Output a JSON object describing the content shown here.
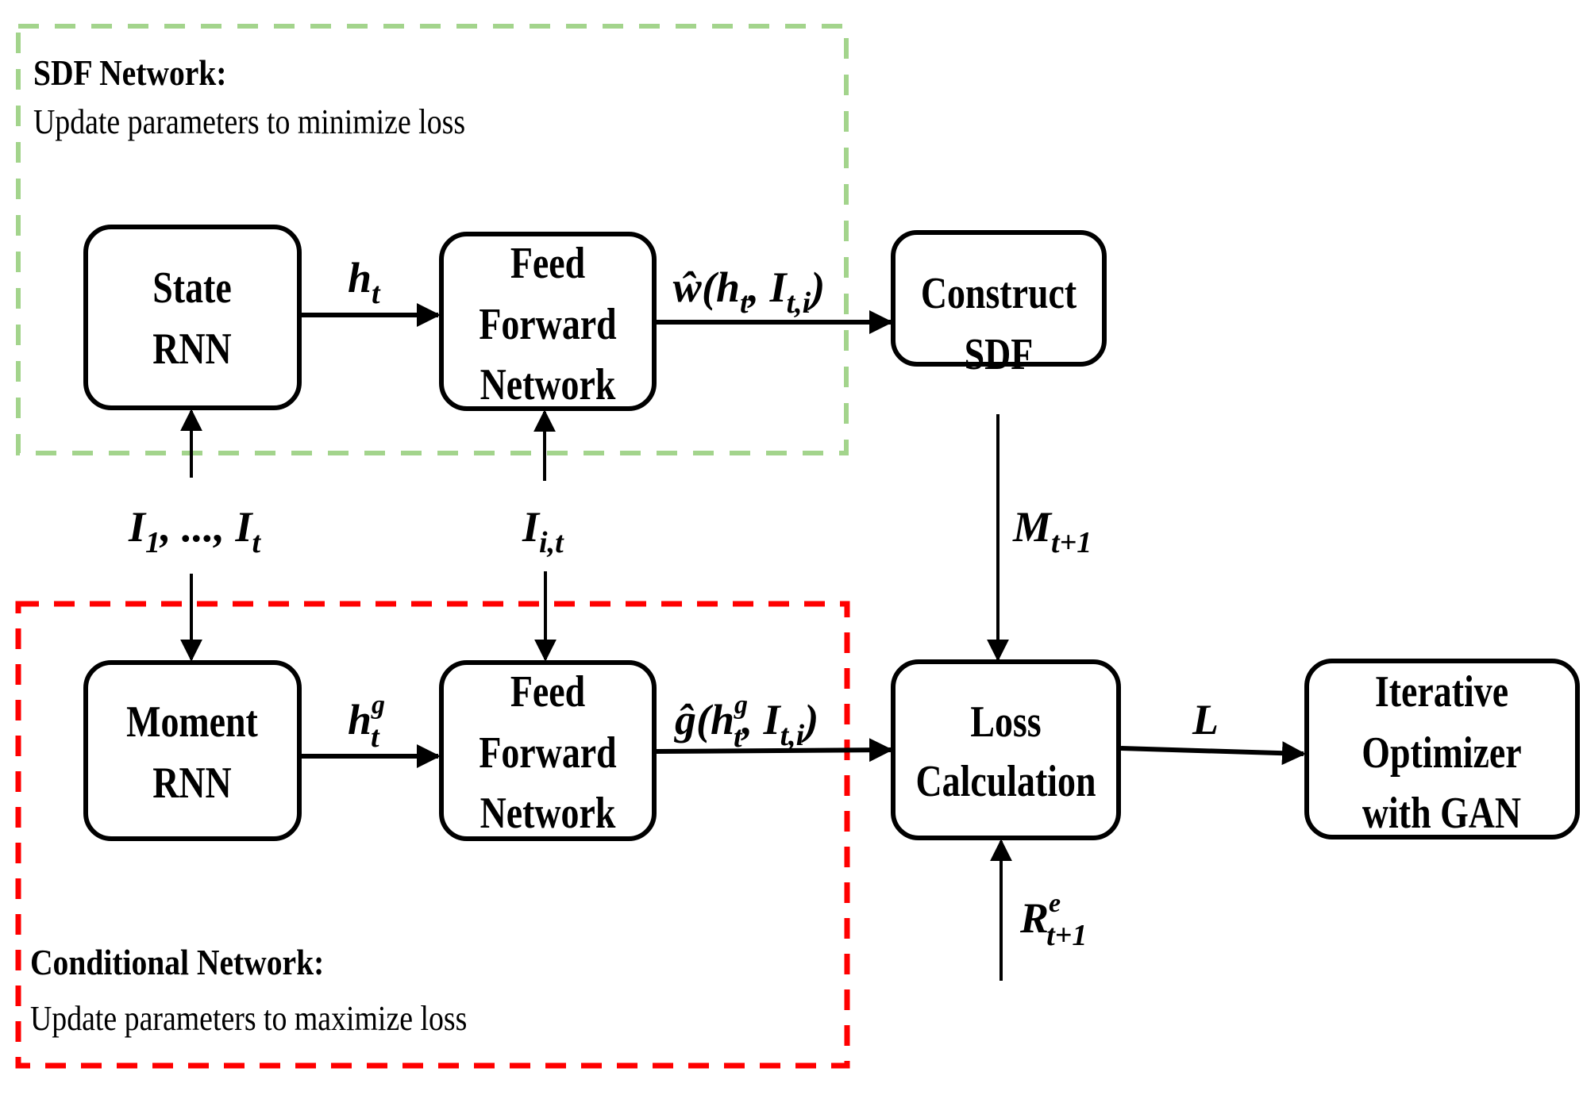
{
  "colors": {
    "sdf_region": "#a3d48c",
    "conditional_region": "#ff0000",
    "box_stroke": "#000000",
    "arrow": "#000000"
  },
  "regions": {
    "sdf": {
      "title": "SDF Network:",
      "subtitle": "Update parameters to minimize loss"
    },
    "conditional": {
      "title": "Conditional Network:",
      "subtitle": "Update parameters to maximize loss"
    }
  },
  "nodes": {
    "state_rnn": {
      "lines": [
        "State",
        "RNN"
      ]
    },
    "ffn_top": {
      "lines": [
        "Feed",
        "Forward",
        "Network"
      ]
    },
    "construct_sdf": {
      "lines": [
        "Construct",
        "SDF"
      ]
    },
    "moment_rnn": {
      "lines": [
        "Moment",
        "RNN"
      ]
    },
    "ffn_bottom": {
      "lines": [
        "Feed",
        "Forward",
        "Network"
      ]
    },
    "loss_calc": {
      "lines": [
        "Loss",
        "Calculation"
      ]
    },
    "optimizer": {
      "lines": [
        "Iterative",
        "Optimizer",
        "with GAN"
      ]
    }
  },
  "edges": {
    "h_t": {
      "base": "h",
      "sub": "t",
      "from": "State RNN",
      "to": "Feed Forward Network (top)"
    },
    "w_hat": {
      "text": "ŵ(h",
      "sub1": "t",
      "mid": ", I",
      "sub2": "t,i",
      "close": ")",
      "from": "Feed Forward Network (top)",
      "to": "Construct SDF"
    },
    "inputs_all": {
      "base": "I",
      "sub1": "1",
      "mid": ", ..., I",
      "sub2": "t",
      "to": [
        "State RNN",
        "Moment RNN"
      ]
    },
    "input_i": {
      "base": "I",
      "sub": "i,t",
      "to": [
        "Feed Forward Network (top)",
        "Feed Forward Network (bottom)"
      ]
    },
    "h_t_g": {
      "base": "h",
      "sub": "t",
      "sup": "g",
      "from": "Moment RNN",
      "to": "Feed Forward Network (bottom)"
    },
    "g_hat": {
      "text": "ĝ(h",
      "sub1": "t",
      "sup1": "g",
      "mid": ", I",
      "sub2": "t,i",
      "close": ")",
      "from": "Feed Forward Network (bottom)",
      "to": "Loss Calculation"
    },
    "m_next": {
      "base": "M",
      "sub": "t+1",
      "from": "Construct SDF",
      "to": "Loss Calculation"
    },
    "loss_L": {
      "base": "L",
      "from": "Loss Calculation",
      "to": "Iterative Optimizer with GAN"
    },
    "r_excess": {
      "base": "R",
      "sub": "t+1",
      "sup": "e",
      "to": "Loss Calculation"
    }
  }
}
